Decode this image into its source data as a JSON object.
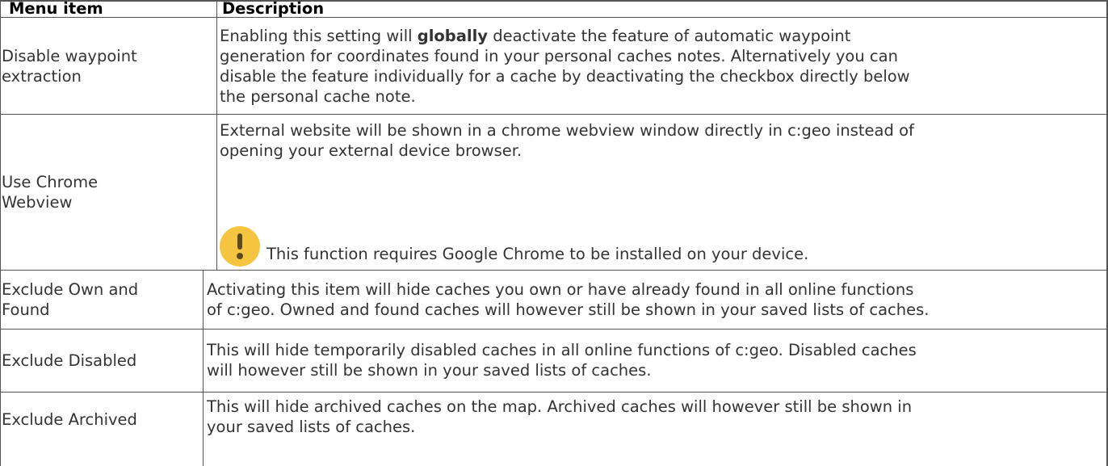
{
  "table": {
    "header": {
      "col1": "Menu item",
      "col2": "Description"
    },
    "rows": [
      {
        "item": [
          "Disable waypoint",
          "extraction"
        ],
        "description": {
          "line1_pre": "Enabling this setting will ",
          "line1_bold": "globally",
          "line1_post": " deactivate the feature of automatic waypoint",
          "line2": "generation for coordinates found in your personal caches notes. Alternatively you can",
          "line3": "disable the feature individually for a cache by deactivating the checkbox directly below",
          "line4": "the personal cache note."
        }
      },
      {
        "item": [
          "Use Chrome",
          "Webview"
        ],
        "description": {
          "line1": "External website will be shown in a chrome webview window directly in c:geo instead of",
          "line2": "opening your external device browser.",
          "note_icon": "exclamation-warning-icon",
          "note_text": "This function requires Google Chrome to be installed on your device."
        }
      },
      {
        "item": [
          "Exclude Own and",
          "Found"
        ],
        "description": {
          "line1": "Activating this item will hide caches you own or have already found in all online functions",
          "line2": "of c:geo. Owned and found caches will however still be shown in your saved lists of caches."
        }
      },
      {
        "item": [
          "Exclude Disabled"
        ],
        "description": {
          "line1": "This will hide temporarily disabled caches in all online functions of c:geo. Disabled caches",
          "line2": "will however still be shown in your saved lists of caches."
        }
      },
      {
        "item": [
          "Exclude Archived"
        ],
        "description": {
          "line1": "This will hide archived caches on the map. Archived caches will however still be shown in",
          "line2": "your saved lists of caches."
        }
      }
    ],
    "colors": {
      "border": "#555555",
      "text": "#333333",
      "header_text": "#000000",
      "warning_icon": "#f5c542"
    }
  }
}
